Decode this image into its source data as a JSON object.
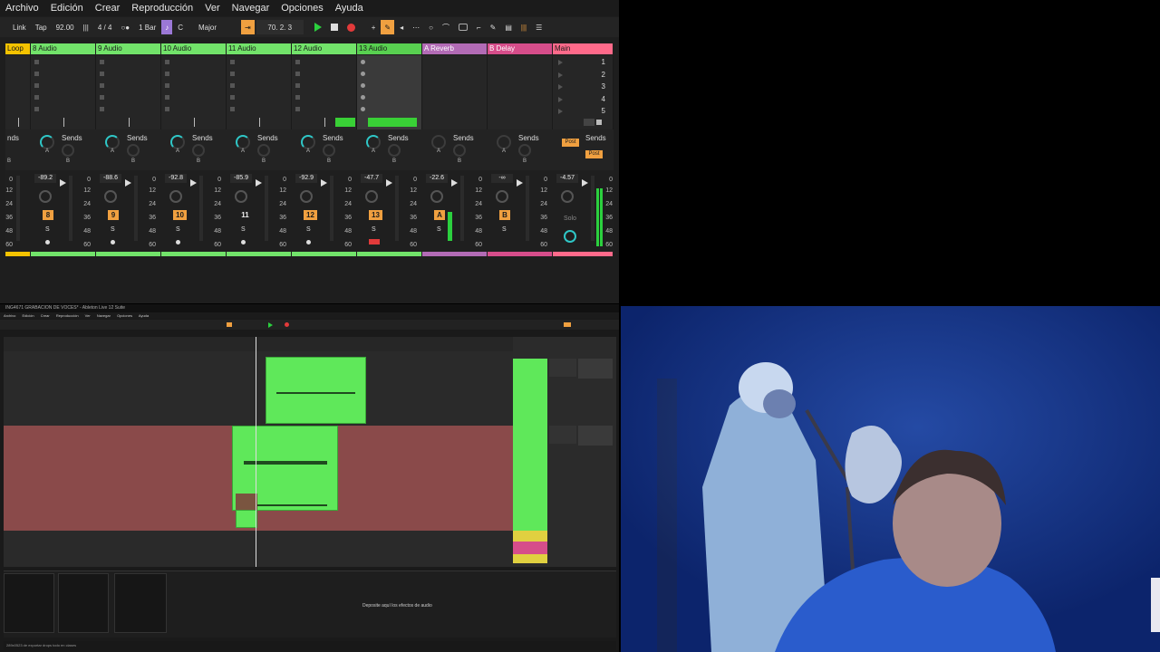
{
  "top_app": {
    "menu": [
      "Archivo",
      "Edición",
      "Crear",
      "Reproducción",
      "Ver",
      "Navegar",
      "Opciones",
      "Ayuda"
    ],
    "transport": {
      "link": "Link",
      "tap": "Tap",
      "tempo": "92.00",
      "time_signature": "4 / 4",
      "quantize": "1 Bar",
      "key": "C",
      "scale": "Major",
      "position": "70.  2.  3"
    },
    "tracks": [
      {
        "name": "Loop",
        "num": "",
        "vol": "",
        "kind": "loop"
      },
      {
        "name": "8 Audio",
        "num": "8",
        "vol": "-89.2",
        "kind": "audio"
      },
      {
        "name": "9 Audio",
        "num": "9",
        "vol": "-88.6",
        "kind": "audio"
      },
      {
        "name": "10 Audio",
        "num": "10",
        "vol": "-92.8",
        "kind": "audio"
      },
      {
        "name": "11 Audio",
        "num": "11",
        "vol": "-85.9",
        "kind": "audio"
      },
      {
        "name": "12 Audio",
        "num": "12",
        "vol": "-92.9",
        "kind": "audio"
      },
      {
        "name": "13 Audio",
        "num": "13",
        "vol": "-47.7",
        "kind": "audio"
      },
      {
        "name": "A Reverb",
        "num": "A",
        "vol": "-22.6",
        "kind": "return"
      },
      {
        "name": "B Delay",
        "num": "B",
        "vol": "-∞",
        "kind": "return"
      },
      {
        "name": "Main",
        "num": "",
        "vol": "-4.57",
        "kind": "main"
      }
    ],
    "scenes": [
      "1",
      "2",
      "3",
      "4",
      "5"
    ],
    "sends_label": "Sends",
    "sends_label_cut": "nds",
    "knob_a": "A",
    "knob_b": "B",
    "post_label": "Post",
    "solo_label": "Solo",
    "s_label": "S",
    "db_scale": [
      "0",
      "12",
      "24",
      "36",
      "48",
      "60"
    ],
    "colors": {
      "green": "#72e36a",
      "loop_yellow": "#f5c300",
      "reverb": "#b26bb5",
      "delay": "#d64d8a",
      "main": "#ff6a8a",
      "accent_orange": "#f0a040",
      "teal": "#2fc7c7",
      "record_red": "#e23a3a"
    }
  },
  "bottom_app": {
    "title": "ING4671 GRABACION DE VOCES* - Ableton Live 12 Suite",
    "menu": [
      "Archivo",
      "Edición",
      "Crear",
      "Reproducción",
      "Ver",
      "Navegar",
      "Opciones",
      "Ayuda"
    ],
    "drop_hint": "Deposite aquí los efectos de audio",
    "status": "289x0523 de exportar drops todo en clases"
  },
  "webcam": {
    "description_icon": "webcam-feed"
  }
}
